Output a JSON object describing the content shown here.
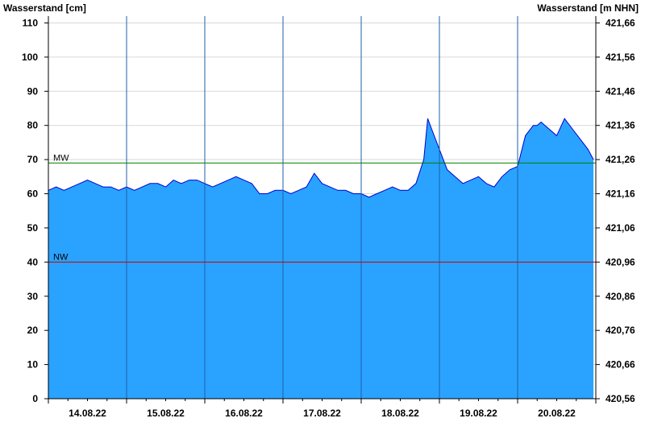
{
  "chart_data": {
    "type": "area",
    "ylabel_left": "Wasserstand [cm]",
    "ylabel_right": "Wasserstand [m NHN]",
    "ylim_left": [
      0,
      112
    ],
    "y_ticks_left": [
      0,
      10,
      20,
      30,
      40,
      50,
      60,
      70,
      80,
      90,
      100,
      110
    ],
    "y_ticks_right": [
      "420,56",
      "420,66",
      "420,76",
      "420,86",
      "420,96",
      "421,06",
      "421,16",
      "421,26",
      "421,36",
      "421,46",
      "421,56",
      "421,66"
    ],
    "x_days": [
      "14.08.22",
      "15.08.22",
      "16.08.22",
      "17.08.22",
      "18.08.22",
      "19.08.22",
      "20.08.22"
    ],
    "grid": true,
    "reference_lines": [
      {
        "label": "MW",
        "value": 69,
        "color": "#008000"
      },
      {
        "label": "NW",
        "value": 40,
        "color": "#cc0000"
      }
    ],
    "series": [
      {
        "fill": "#29a3ff",
        "stroke": "#0000cc",
        "x_days": [
          0,
          0.1,
          0.2,
          0.3,
          0.4,
          0.5,
          0.6,
          0.7,
          0.8,
          0.9,
          1.0,
          1.1,
          1.2,
          1.3,
          1.4,
          1.5,
          1.6,
          1.7,
          1.8,
          1.9,
          2.0,
          2.1,
          2.2,
          2.3,
          2.4,
          2.5,
          2.6,
          2.7,
          2.8,
          2.9,
          3.0,
          3.1,
          3.2,
          3.3,
          3.4,
          3.5,
          3.6,
          3.7,
          3.8,
          3.9,
          4.0,
          4.1,
          4.2,
          4.3,
          4.4,
          4.5,
          4.6,
          4.7,
          4.8,
          4.85,
          4.9,
          5.0,
          5.1,
          5.2,
          5.3,
          5.4,
          5.5,
          5.6,
          5.7,
          5.8,
          5.9,
          6.0,
          6.1,
          6.2,
          6.25,
          6.3,
          6.4,
          6.5,
          6.6,
          6.7,
          6.8,
          6.9,
          6.97
        ],
        "values": [
          61,
          62,
          61,
          62,
          63,
          64,
          63,
          62,
          62,
          61,
          62,
          61,
          62,
          63,
          63,
          62,
          64,
          63,
          64,
          64,
          63,
          62,
          63,
          64,
          65,
          64,
          63,
          60,
          60,
          61,
          61,
          60,
          61,
          62,
          66,
          63,
          62,
          61,
          61,
          60,
          60,
          59,
          60,
          61,
          62,
          61,
          61,
          63,
          70,
          82,
          79,
          73,
          67,
          65,
          63,
          64,
          65,
          63,
          62,
          65,
          67,
          68,
          77,
          80,
          80,
          81,
          79,
          77,
          82,
          79,
          76,
          73,
          70
        ]
      }
    ]
  }
}
